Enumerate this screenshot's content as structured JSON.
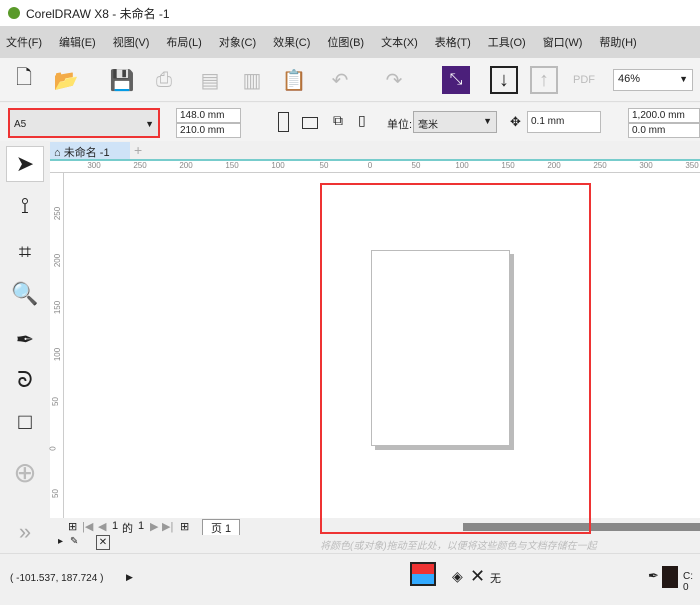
{
  "title": "CorelDRAW X8 - 未命名 -1",
  "menu": [
    "文件(F)",
    "编辑(E)",
    "视图(V)",
    "布局(L)",
    "对象(C)",
    "效果(C)",
    "位图(B)",
    "文本(X)",
    "表格(T)",
    "工具(O)",
    "窗口(W)",
    "帮助(H)"
  ],
  "toolbar": {
    "zoom": "46%",
    "pdf_label": "PDF"
  },
  "property_bar": {
    "page_size": "A5",
    "width": "148.0 mm",
    "height": "210.0 mm",
    "unit_label": "单位:",
    "unit": "毫米",
    "nudge": "0.1 mm",
    "dup_x": "1,200.0 mm",
    "dup_y": "0.0 mm"
  },
  "document_tab": "未命名 -1",
  "hruler": [
    "300",
    "250",
    "200",
    "150",
    "100",
    "50",
    "0",
    "50",
    "100",
    "150",
    "200",
    "250",
    "300",
    "350"
  ],
  "vruler": [
    "250",
    "200",
    "150",
    "100",
    "50",
    "0",
    "50"
  ],
  "page_nav": {
    "current": "1",
    "of": "的",
    "total": "1",
    "page_tab": "页 1"
  },
  "palette_hint": "将颜色(或对象)拖动至此处，以便将这些颜色与文档存储在一起",
  "status": {
    "coords": "( -101.537, 187.724 )",
    "fill": "无",
    "outline": "C: 0"
  }
}
